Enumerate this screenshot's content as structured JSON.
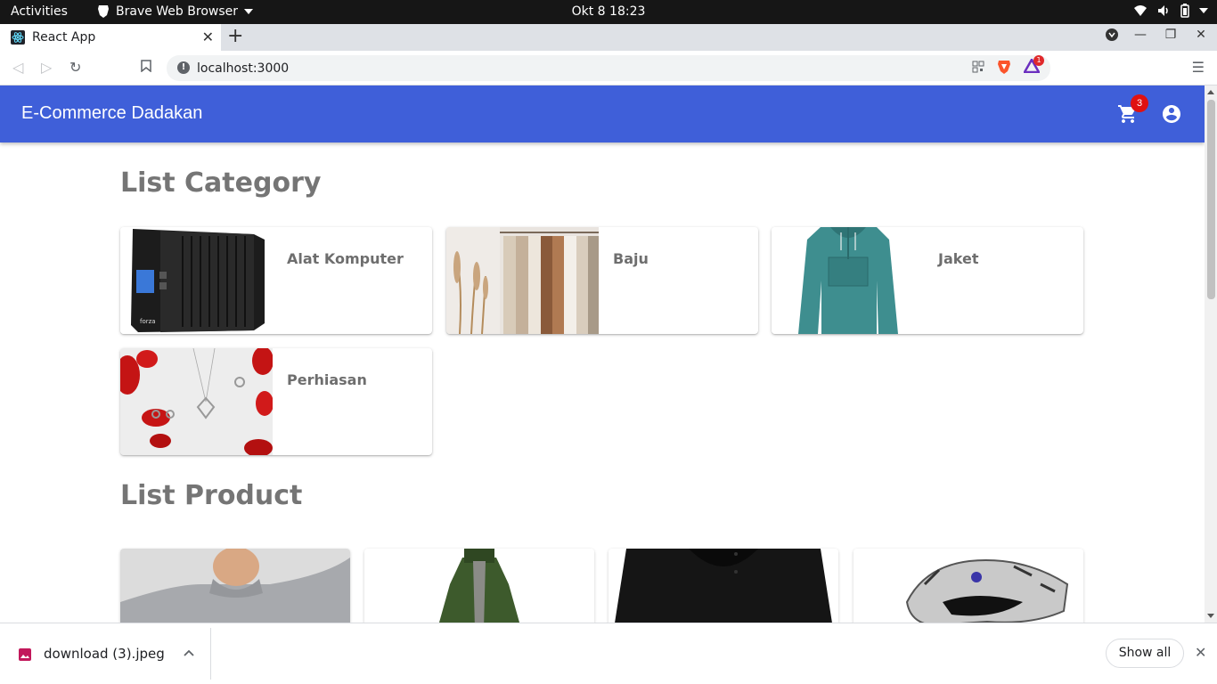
{
  "system": {
    "activities": "Activities",
    "app_menu": "Brave Web Browser",
    "clock": "Okt 8  18:23"
  },
  "browser": {
    "tab_title": "React App",
    "address": "localhost:3000",
    "brave_rewards_count": "1"
  },
  "app": {
    "brand": "E-Commerce Dadakan",
    "cart_count": "3",
    "brand_color": "#3f5fd9"
  },
  "category_section": {
    "title": "List Category",
    "items": [
      {
        "label": "Alat Komputer",
        "icon": "ups-device-image"
      },
      {
        "label": "Baju",
        "icon": "clothes-rack-image"
      },
      {
        "label": "Jaket",
        "icon": "teal-jacket-image"
      },
      {
        "label": "Perhiasan",
        "icon": "jewelry-image"
      }
    ]
  },
  "product_section": {
    "title": "List Product",
    "items": [
      {
        "icon": "grey-sweater-image"
      },
      {
        "icon": "green-jacket-image"
      },
      {
        "icon": "black-shirt-image"
      },
      {
        "icon": "dragon-ring-image"
      }
    ]
  },
  "downloads": {
    "file_name": "download (3).jpeg",
    "show_all": "Show all"
  }
}
